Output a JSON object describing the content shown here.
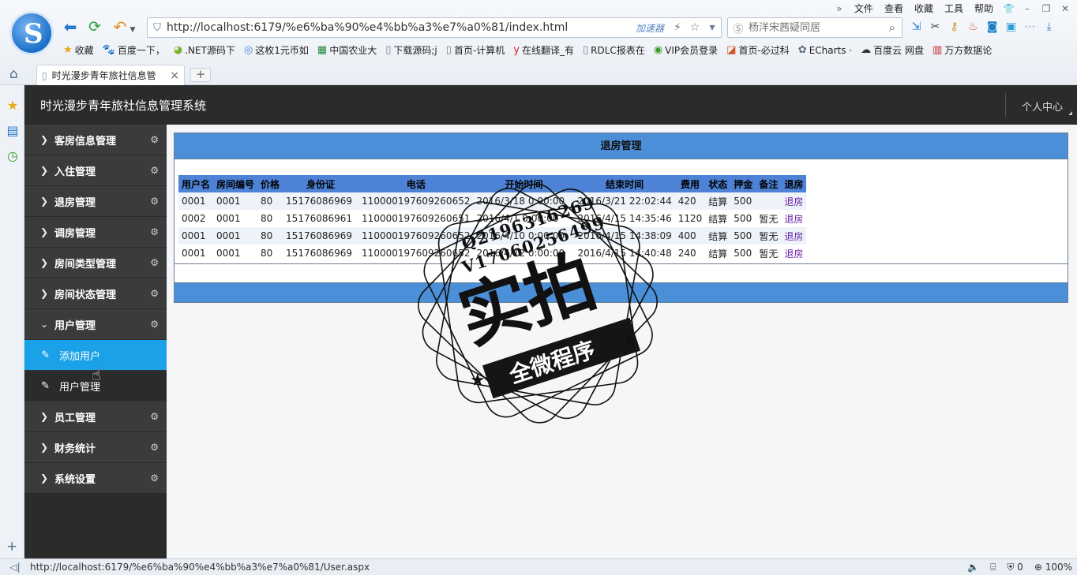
{
  "browser": {
    "menu": [
      "文件",
      "查看",
      "收藏",
      "工具",
      "帮助"
    ],
    "address": "http://localhost:6179/%e6%ba%90%e4%bb%a3%e7%a0%81/index.html",
    "accelerator": "加速器",
    "search_placeholder": "杨洋宋茜疑同居",
    "bookmarks": [
      {
        "icon": "star-icon",
        "label": "收藏"
      },
      {
        "icon": "baidu-paw-icon",
        "label": "百度一下，"
      },
      {
        "icon": "net-icon",
        "label": ".NET源码下"
      },
      {
        "icon": "chrome-icon",
        "label": "这枚1元币如"
      },
      {
        "icon": "bank-icon",
        "label": "中国农业大"
      },
      {
        "icon": "page-icon",
        "label": "下载源码;j"
      },
      {
        "icon": "page-icon",
        "label": "首页-计算机"
      },
      {
        "icon": "youdao-icon",
        "label": "在线翻译_有"
      },
      {
        "icon": "page-icon",
        "label": "RDLC报表在"
      },
      {
        "icon": "vip-icon",
        "label": "VIP会员登录"
      },
      {
        "icon": "guoguo-icon",
        "label": "首页-必过科"
      },
      {
        "icon": "echarts-icon",
        "label": "ECharts ·"
      },
      {
        "icon": "cloud-icon",
        "label": "百度云 网盘"
      },
      {
        "icon": "wanfang-icon",
        "label": "万方数据论"
      }
    ],
    "tab_title": "时光漫步青年旅社信息管",
    "status_url": "http://localhost:6179/%e6%ba%90%e4%bb%a3%e7%a0%81/User.aspx",
    "status_count": "0",
    "zoom": "100%"
  },
  "app": {
    "title": "时光漫步青年旅社信息管理系统",
    "personal_center": "个人中心"
  },
  "sidebar": {
    "items_top": [
      {
        "label": "客房信息管理"
      },
      {
        "label": "入住管理"
      },
      {
        "label": "退房管理"
      },
      {
        "label": "调房管理"
      },
      {
        "label": "房间类型管理"
      },
      {
        "label": "房间状态管理"
      },
      {
        "label": "用户管理"
      }
    ],
    "subitems": [
      {
        "label": "添加用户"
      },
      {
        "label": "用户管理"
      }
    ],
    "items_bottom": [
      {
        "label": "员工管理"
      },
      {
        "label": "财务统计"
      },
      {
        "label": "系统设置"
      }
    ]
  },
  "panel": {
    "title": "退房管理",
    "columns": [
      "用户名",
      "房间编号",
      "价格",
      "身份证",
      "电话",
      "开始时间",
      "结束时间",
      "费用",
      "状态",
      "押金",
      "备注",
      "退房"
    ],
    "rows": [
      [
        "0001",
        "0001",
        "80",
        "15176086969",
        "110000197609260652",
        "2016/3/18 0:00:00",
        "2016/3/21 22:02:44",
        "420",
        "结算",
        "500",
        "",
        "退房"
      ],
      [
        "0002",
        "0001",
        "80",
        "15176086961",
        "110000197609260651",
        "2016/4/1 0:00:00",
        "2016/4/15 14:35:46",
        "1120",
        "结算",
        "500",
        "暂无",
        "退房"
      ],
      [
        "0001",
        "0001",
        "80",
        "15176086969",
        "110000197609260652",
        "2016/4/10 0:00:00",
        "2016/4/15 14:38:09",
        "400",
        "结算",
        "500",
        "暂无",
        "退房"
      ],
      [
        "0001",
        "0001",
        "80",
        "15176086969",
        "110000197609260652",
        "2016/4/12 0:00:00",
        "2016/4/15 14:40:48",
        "240",
        "结算",
        "500",
        "暂无",
        "退房"
      ]
    ]
  },
  "watermark": {
    "line1": "Q2196316269",
    "line2": "V17060256499",
    "big": "实拍",
    "band": "全微程序"
  },
  "colors": {
    "header_bg": "#2b2b2b",
    "active_item": "#1ba1e8",
    "panel_blue": "#4b8fd8",
    "link_purple": "#6b1fa8"
  }
}
